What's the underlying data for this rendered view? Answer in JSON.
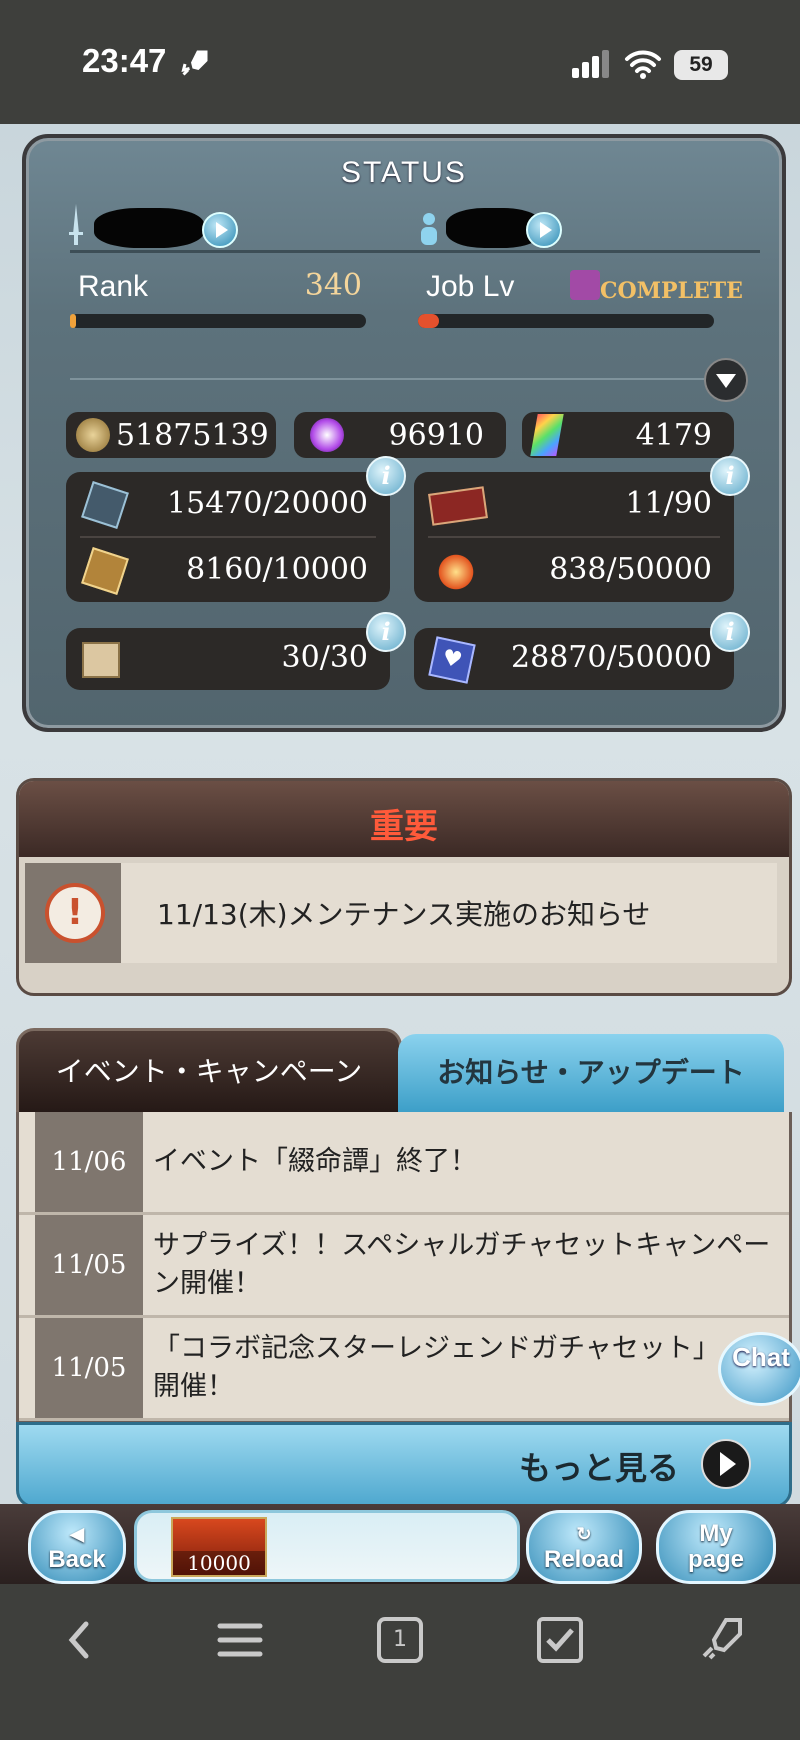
{
  "status_bar": {
    "time": "23:47",
    "battery": "59"
  },
  "status_panel": {
    "title": "STATUS",
    "rank_label": "Rank",
    "rank_value": "340",
    "rank_progress": 0.02,
    "job_label": "Job Lv",
    "job_value": "COMPLETE",
    "job_progress": 0.07,
    "crystals_gold": "51875139",
    "crystals_purple": "96910",
    "crystals_rainbow": "4179",
    "ap": "15470/20000",
    "ep": "8160/10000",
    "tickets": "11/90",
    "burst": "838/50000",
    "boxes": "30/30",
    "hearts": "28870/50000",
    "info_glyph": "i"
  },
  "important": {
    "title": "重要",
    "items": [
      {
        "text": "11/13(木)メンテナンス実施のお知らせ"
      }
    ]
  },
  "tabs": {
    "events": "イベント・キャンペーン",
    "news": "お知らせ・アップデート"
  },
  "news": [
    {
      "date": "11/06",
      "text": "イベント「綴命譚」終了！"
    },
    {
      "date": "11/05",
      "text": "サプライズ！！スペシャルガチャセットキャンペーン開催！"
    },
    {
      "date": "11/05",
      "text": "「コラボ記念スターレジェンドガチャセット」開催！"
    }
  ],
  "more_label": "もっと見る",
  "chat_label": "Chat",
  "game_nav": {
    "back": "Back",
    "item_count": "10000",
    "reload": "Reload",
    "mypage_line1": "My",
    "mypage_line2": "page"
  },
  "browser": {
    "tab_count": "1"
  },
  "colors": {
    "accent_blue": "#4fa8cf",
    "important_red": "#ff5a3a",
    "gold": "#f4d59b"
  }
}
